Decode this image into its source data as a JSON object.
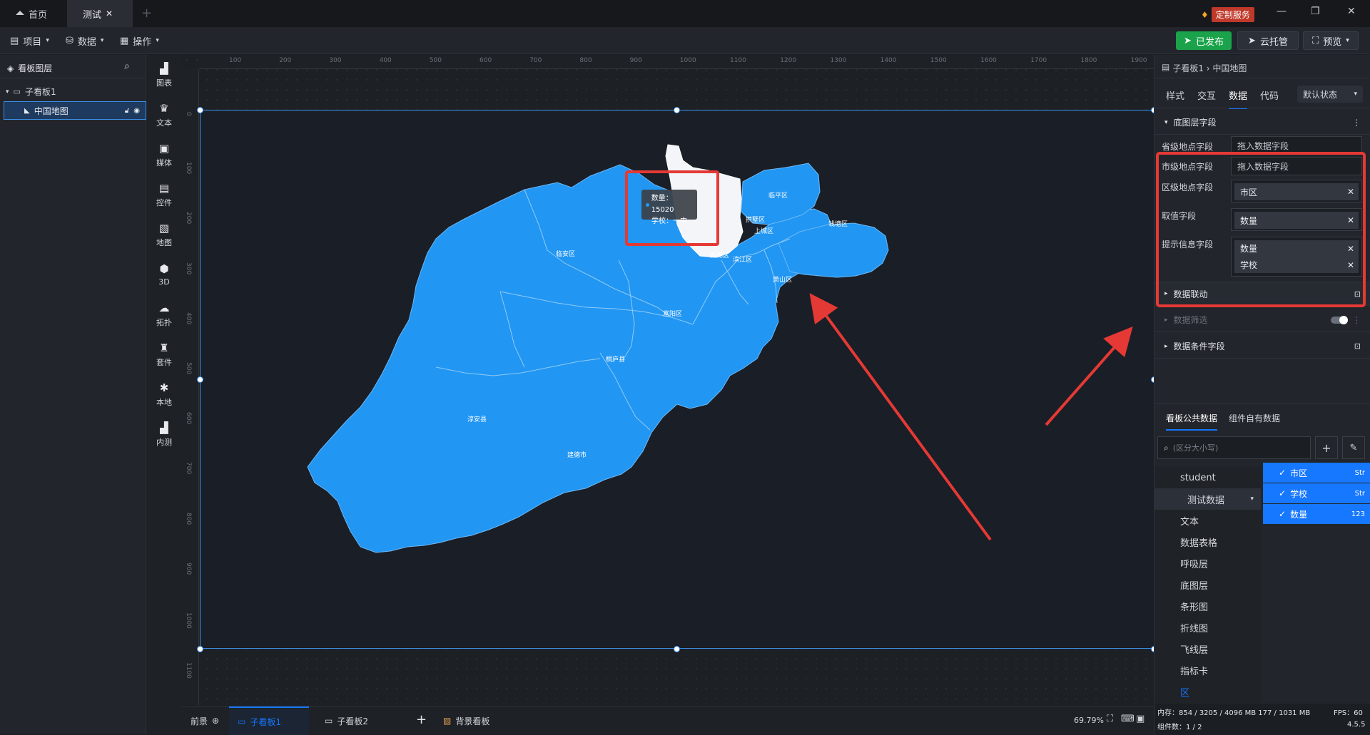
{
  "titlebar": {
    "tabs": [
      {
        "label": "首页"
      },
      {
        "label": "测试"
      }
    ],
    "custom_service": "定制服务"
  },
  "toolbar": {
    "menus": [
      "项目",
      "数据",
      "操作"
    ],
    "publish": "已发布",
    "cloud": "云托管",
    "preview": "预览"
  },
  "layers": {
    "title": "看板图层",
    "tree": [
      {
        "label": "子看板1"
      },
      {
        "label": "中国地图"
      }
    ]
  },
  "components": [
    "图表",
    "文本",
    "媒体",
    "控件",
    "地图",
    "3D",
    "拓扑",
    "套件",
    "本地",
    "内测"
  ],
  "ruler": {
    "top": [
      "100",
      "200",
      "300",
      "400",
      "500",
      "600",
      "700",
      "800",
      "900",
      "1000",
      "1100",
      "1200",
      "1300",
      "1400",
      "1500",
      "1600",
      "1700",
      "1800",
      "1900"
    ],
    "left": [
      "0",
      "100",
      "200",
      "300",
      "400",
      "500",
      "600",
      "700",
      "800",
      "900",
      "1000",
      "1100"
    ]
  },
  "map": {
    "districts": [
      "临平区",
      "临安区",
      "拱墅区",
      "上城区",
      "钱塘区",
      "西湖区",
      "滨江区",
      "萧山区",
      "富阳区",
      "桐庐县",
      "淳安县",
      "建德市"
    ],
    "tooltip": {
      "line1": "数量：15020",
      "line2": "学校：一中"
    }
  },
  "bottombar": {
    "front": "前景",
    "tabs": [
      "子看板1",
      "子看板2"
    ],
    "background": "背景看板",
    "zoom": "69.79%"
  },
  "rpanel": {
    "breadcrumb": "子看板1 › 中国地图",
    "tabs": [
      "样式",
      "交互",
      "数据",
      "代码"
    ],
    "state": "默认状态",
    "section_base": "底图层字段",
    "fields": [
      {
        "label": "省级地点字段",
        "placeholder": "拖入数据字段"
      },
      {
        "label": "市级地点字段",
        "placeholder": "拖入数据字段"
      }
    ],
    "district_label": "区级地点字段",
    "district_value": "市区",
    "value_label": "取值字段",
    "value_value": "数量",
    "tip_label": "提示信息字段",
    "tip_values": [
      "数量",
      "学校"
    ],
    "data_link": "数据联动",
    "data_filter": "数据筛选",
    "data_condition": "数据条件字段",
    "data_tabs": [
      "看板公共数据",
      "组件自有数据"
    ],
    "search_placeholder": "(区分大小写)",
    "data_list": [
      "student",
      "测试数据",
      "文本",
      "数据表格",
      "呼吸层",
      "底图层",
      "条形图",
      "折线图",
      "飞线层",
      "指标卡",
      "区"
    ],
    "data_fields": [
      {
        "name": "市区",
        "type": "Str"
      },
      {
        "name": "学校",
        "type": "Str"
      },
      {
        "name": "数量",
        "type": "123"
      }
    ],
    "status_memory": "内存：854 / 3205 / 4096 MB  177 / 1031 MB",
    "status_fps": "FPS：60",
    "status_comp": "组件数：1 / 2",
    "version": "4.5.5"
  },
  "colors": {
    "accent": "#1677ff",
    "map_fill": "#2196f3",
    "annotation": "#e53935",
    "publish": "#1aa34a"
  }
}
